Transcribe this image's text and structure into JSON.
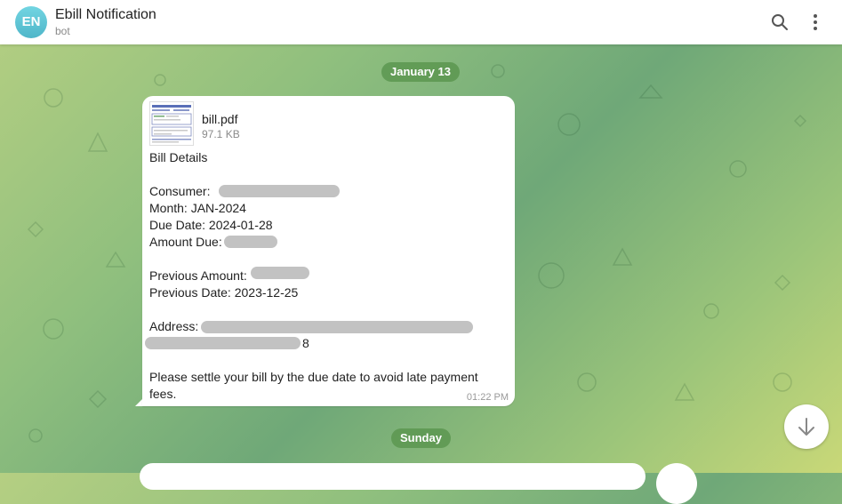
{
  "header": {
    "avatar_initials": "EN",
    "title": "Ebill Notification",
    "subtitle": "bot",
    "search_icon": "search-icon",
    "menu_icon": "more-vertical-icon"
  },
  "dates": {
    "first": "January 13",
    "second": "Sunday"
  },
  "message": {
    "file_name": "bill.pdf",
    "file_size": "97.1 KB",
    "heading": "Bill Details",
    "consumer_label": "Consumer:",
    "month": "Month: JAN-2024",
    "due_date": "Due Date: 2024-01-28",
    "amount_due_label": "Amount Due:",
    "previous_amount_label": "Previous Amount:",
    "previous_date": "Previous Date: 2023-12-25",
    "address_label": "Address:",
    "address_tail": "8",
    "notice_line1": "Please settle your bill by the due date to avoid late payment",
    "notice_line2": "fees.",
    "time": "01:22 PM"
  },
  "scroll_button_icon": "arrow-down-icon",
  "colors": {
    "accent_pill": "#5c9650",
    "avatar": "#5bc2d2"
  }
}
